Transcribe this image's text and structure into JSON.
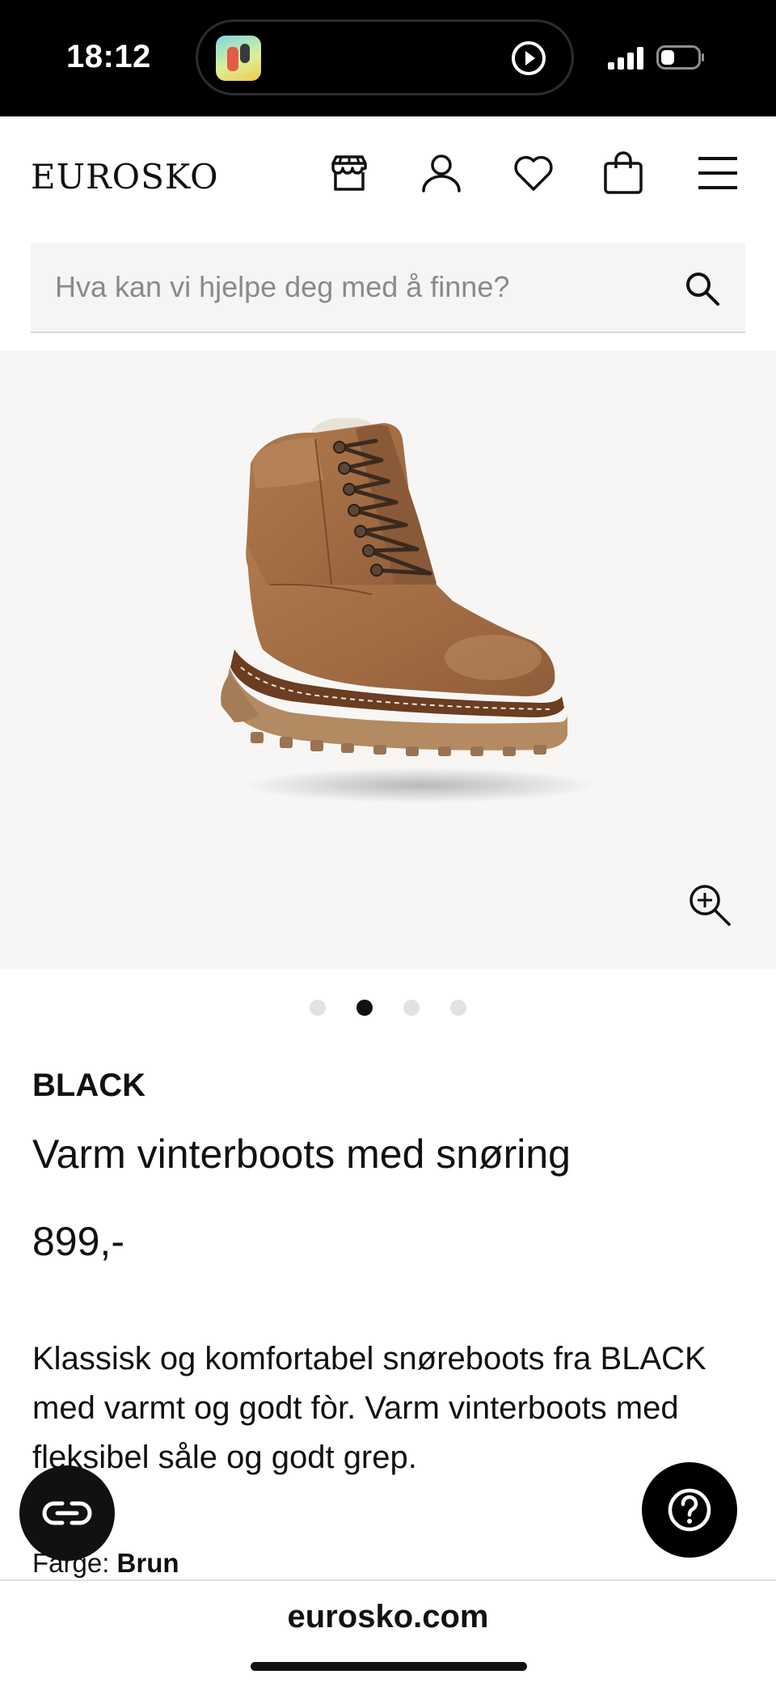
{
  "status_bar": {
    "time": "18:12",
    "icons": [
      "app-thumbnail-icon",
      "play-circle-icon",
      "signal-icon",
      "battery-icon"
    ]
  },
  "header": {
    "logo": "EUROSKO",
    "icons": [
      "store-icon",
      "account-icon",
      "heart-icon",
      "bag-icon",
      "menu-icon"
    ]
  },
  "search": {
    "placeholder": "Hva kan vi hjelpe deg med å finne?",
    "value": ""
  },
  "gallery": {
    "image_alt": "brown lace-up winter boot",
    "total_images": 4,
    "active_index": 1
  },
  "product": {
    "brand": "BLACK",
    "title": "Varm vinterboots med snøring",
    "price": "899,-",
    "description": "Klassisk og komfortabel snøreboots fra BLACK med varmt og godt fòr. Varm vinterboots med fleksibel såle og godt grep.",
    "color_label": "Farge:",
    "color_value": "Brun"
  },
  "browser": {
    "domain": "eurosko.com"
  },
  "colors": {
    "status_bar": "#000000",
    "gallery_bg": "#f7f6f5",
    "search_bg": "#f5f5f5",
    "boot_brown": "#a26e45"
  }
}
